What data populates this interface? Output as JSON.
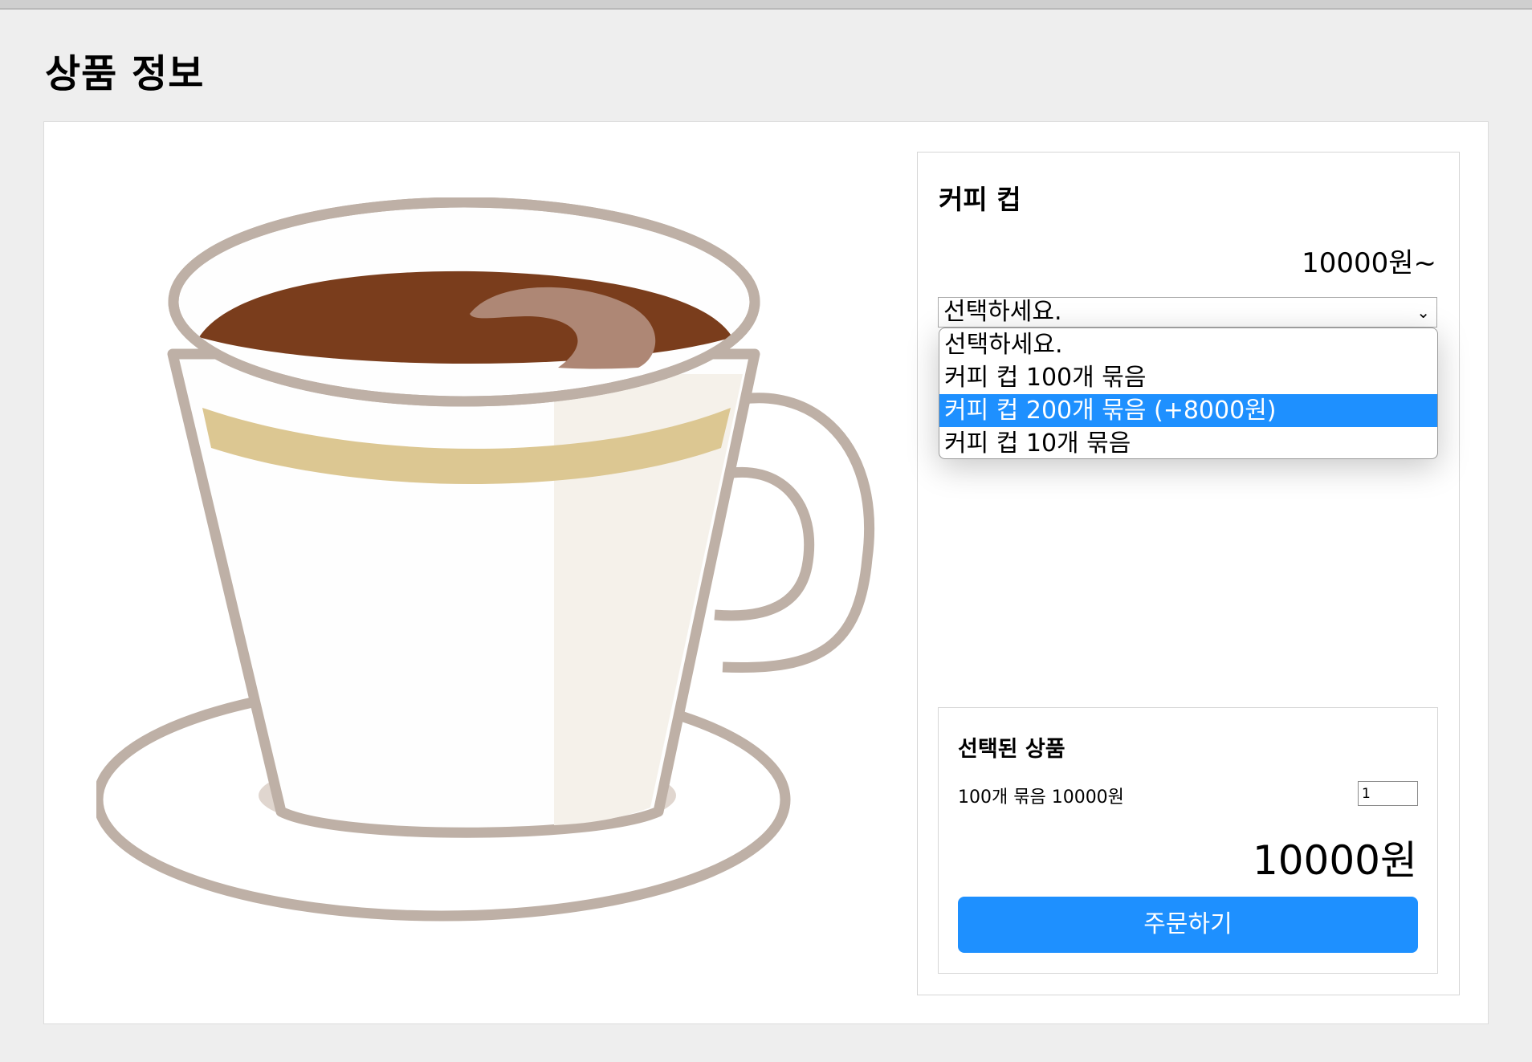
{
  "page": {
    "title": "상품 정보"
  },
  "product": {
    "name": "커피 컵",
    "price": "10000원~",
    "image_icon": "coffee-cup-illustration"
  },
  "option_select": {
    "current": "선택하세요.",
    "options": [
      {
        "label": "선택하세요.",
        "highlighted": false
      },
      {
        "label": "커피 컵 100개 묶음",
        "highlighted": false
      },
      {
        "label": "커피 컵 200개 묶음 (+8000원)",
        "highlighted": true
      },
      {
        "label": "커피 컵 10개 묶음",
        "highlighted": false
      }
    ]
  },
  "selected": {
    "title": "선택된 상품",
    "item": "100개 묶음 10000원",
    "quantity": "1",
    "total": "10000원"
  },
  "order_button": "주문하기",
  "colors": {
    "accent": "#1e90ff",
    "background": "#eeeeee"
  }
}
